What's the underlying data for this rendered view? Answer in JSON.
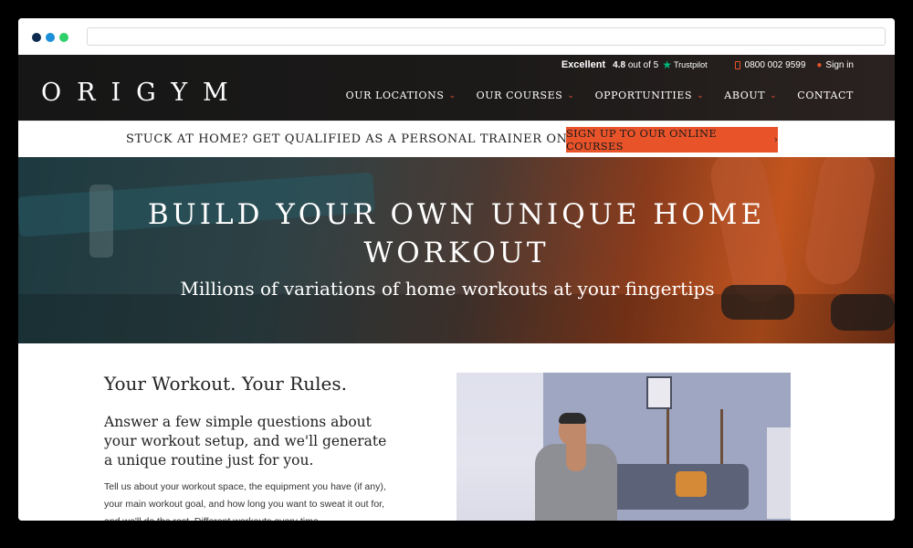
{
  "site": {
    "logo": "ORIGYM"
  },
  "topbar": {
    "rating_word": "Excellent",
    "score": "4.8",
    "score_suffix": "out of 5",
    "trustpilot_label": "Trustpilot",
    "phone": "0800 002 9599",
    "signin": "Sign in"
  },
  "nav": {
    "items": [
      {
        "label": "OUR LOCATIONS",
        "dropdown": true
      },
      {
        "label": "OUR COURSES",
        "dropdown": true
      },
      {
        "label": "OPPORTUNITIES",
        "dropdown": true
      },
      {
        "label": "ABOUT",
        "dropdown": true
      },
      {
        "label": "CONTACT",
        "dropdown": false
      }
    ]
  },
  "promo": {
    "text": "STUCK AT HOME? GET QUALIFIED AS A PERSONAL TRAINER ONLINE",
    "button": "SIGN UP TO OUR ONLINE COURSES"
  },
  "hero": {
    "title_line1": "BUILD YOUR OWN UNIQUE HOME",
    "title_line2": "WORKOUT",
    "subtitle": "Millions of variations of home workouts at your fingertips"
  },
  "content": {
    "heading": "Your Workout. Your Rules.",
    "lead": "Answer a few simple questions about your workout setup, and we'll generate a unique routine just for you.",
    "body": "Tell us about your workout space, the equipment you have (if any), your main workout goal, and how long you want to sweat it out for, and we'll do the rest. Different workouts every time."
  },
  "colors": {
    "accent": "#e8532a",
    "trustpilot_green": "#00b67a",
    "header_bg": "#161616"
  }
}
